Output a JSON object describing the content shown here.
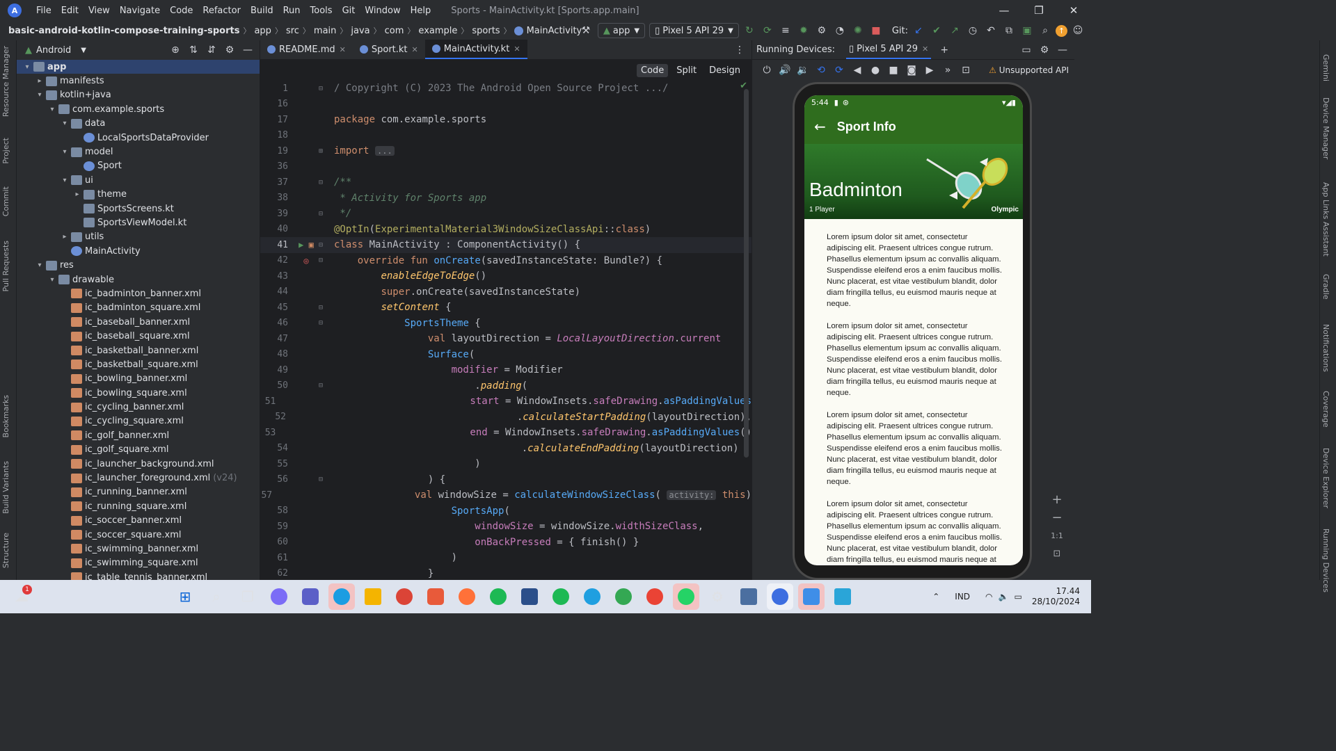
{
  "menubar": {
    "items": [
      "File",
      "Edit",
      "View",
      "Navigate",
      "Code",
      "Refactor",
      "Build",
      "Run",
      "Tools",
      "Git",
      "Window",
      "Help"
    ],
    "title": "Sports - MainActivity.kt [Sports.app.main]"
  },
  "breadcrumb": [
    "basic-android-kotlin-compose-training-sports",
    "app",
    "src",
    "main",
    "java",
    "com",
    "example",
    "sports",
    "MainActivity"
  ],
  "toolbar": {
    "config": "app",
    "device": "Pixel 5 API 29",
    "git_label": "Git:"
  },
  "project": {
    "view": "Android",
    "tree": [
      {
        "label": "app",
        "depth": 0,
        "arrow": "▾",
        "icon": "fold",
        "sel": true
      },
      {
        "label": "manifests",
        "depth": 1,
        "arrow": "▸",
        "icon": "fold"
      },
      {
        "label": "kotlin+java",
        "depth": 1,
        "arrow": "▾",
        "icon": "fold"
      },
      {
        "label": "com.example.sports",
        "depth": 2,
        "arrow": "▾",
        "icon": "fold"
      },
      {
        "label": "data",
        "depth": 3,
        "arrow": "▾",
        "icon": "fold"
      },
      {
        "label": "LocalSportsDataProvider",
        "depth": 4,
        "arrow": "",
        "icon": "kt"
      },
      {
        "label": "model",
        "depth": 3,
        "arrow": "▾",
        "icon": "fold"
      },
      {
        "label": "Sport",
        "depth": 4,
        "arrow": "",
        "icon": "kt"
      },
      {
        "label": "ui",
        "depth": 3,
        "arrow": "▾",
        "icon": "fold"
      },
      {
        "label": "theme",
        "depth": 4,
        "arrow": "▸",
        "icon": "fold"
      },
      {
        "label": "SportsScreens.kt",
        "depth": 4,
        "arrow": "",
        "icon": "fold"
      },
      {
        "label": "SportsViewModel.kt",
        "depth": 4,
        "arrow": "",
        "icon": "fold"
      },
      {
        "label": "utils",
        "depth": 3,
        "arrow": "▸",
        "icon": "fold"
      },
      {
        "label": "MainActivity",
        "depth": 3,
        "arrow": "",
        "icon": "kt"
      },
      {
        "label": "res",
        "depth": 1,
        "arrow": "▾",
        "icon": "fold"
      },
      {
        "label": "drawable",
        "depth": 2,
        "arrow": "▾",
        "icon": "fold"
      },
      {
        "label": "ic_badminton_banner.xml",
        "depth": 3,
        "arrow": "",
        "icon": "xmlf"
      },
      {
        "label": "ic_badminton_square.xml",
        "depth": 3,
        "arrow": "",
        "icon": "xmlf"
      },
      {
        "label": "ic_baseball_banner.xml",
        "depth": 3,
        "arrow": "",
        "icon": "xmlf"
      },
      {
        "label": "ic_baseball_square.xml",
        "depth": 3,
        "arrow": "",
        "icon": "xmlf"
      },
      {
        "label": "ic_basketball_banner.xml",
        "depth": 3,
        "arrow": "",
        "icon": "xmlf"
      },
      {
        "label": "ic_basketball_square.xml",
        "depth": 3,
        "arrow": "",
        "icon": "xmlf"
      },
      {
        "label": "ic_bowling_banner.xml",
        "depth": 3,
        "arrow": "",
        "icon": "xmlf"
      },
      {
        "label": "ic_bowling_square.xml",
        "depth": 3,
        "arrow": "",
        "icon": "xmlf"
      },
      {
        "label": "ic_cycling_banner.xml",
        "depth": 3,
        "arrow": "",
        "icon": "xmlf"
      },
      {
        "label": "ic_cycling_square.xml",
        "depth": 3,
        "arrow": "",
        "icon": "xmlf"
      },
      {
        "label": "ic_golf_banner.xml",
        "depth": 3,
        "arrow": "",
        "icon": "xmlf"
      },
      {
        "label": "ic_golf_square.xml",
        "depth": 3,
        "arrow": "",
        "icon": "xmlf"
      },
      {
        "label": "ic_launcher_background.xml",
        "depth": 3,
        "arrow": "",
        "icon": "xmlf"
      },
      {
        "label": "ic_launcher_foreground.xml",
        "depth": 3,
        "arrow": "",
        "icon": "xmlf",
        "dim": "(v24)"
      },
      {
        "label": "ic_running_banner.xml",
        "depth": 3,
        "arrow": "",
        "icon": "xmlf"
      },
      {
        "label": "ic_running_square.xml",
        "depth": 3,
        "arrow": "",
        "icon": "xmlf"
      },
      {
        "label": "ic_soccer_banner.xml",
        "depth": 3,
        "arrow": "",
        "icon": "xmlf"
      },
      {
        "label": "ic_soccer_square.xml",
        "depth": 3,
        "arrow": "",
        "icon": "xmlf"
      },
      {
        "label": "ic_swimming_banner.xml",
        "depth": 3,
        "arrow": "",
        "icon": "xmlf"
      },
      {
        "label": "ic_swimming_square.xml",
        "depth": 3,
        "arrow": "",
        "icon": "xmlf"
      },
      {
        "label": "ic_table_tennis_banner.xml",
        "depth": 3,
        "arrow": "",
        "icon": "xmlf"
      }
    ]
  },
  "tabs": [
    {
      "label": "README.md",
      "color": "#6b8fd6"
    },
    {
      "label": "Sport.kt",
      "color": "#6b8fd6"
    },
    {
      "label": "MainActivity.kt",
      "color": "#6b8fd6",
      "active": true
    }
  ],
  "viewmodes": [
    "Code",
    "Split",
    "Design"
  ],
  "left_tools": [
    "Resource Manager",
    "Project",
    "Commit",
    "Pull Requests",
    "Bookmarks",
    "Build Variants",
    "Structure"
  ],
  "right_tools": [
    "Gemini",
    "Device Manager",
    "App Links Assistant",
    "Gradle",
    "Notifications",
    "Coverage",
    "Device Explorer",
    "Running Devices"
  ],
  "devices": {
    "header": "Running Devices:",
    "tab": "Pixel 5 API 29",
    "warning": "Unsupported API"
  },
  "phone": {
    "time": "5:44",
    "appbar_title": "Sport Info",
    "sport": "Badminton",
    "players": "1 Player",
    "olympic": "Olympic",
    "paragraph": "Lorem ipsum dolor sit amet, consectetur adipiscing elit. Praesent ultrices congue rutrum. Phasellus elementum ipsum ac convallis aliquam. Suspendisse eleifend eros a enim faucibus mollis. Nunc placerat, est vitae vestibulum blandit, dolor diam fringilla tellus, eu euismod mauris neque at neque.",
    "paragraph_count": 4
  },
  "zoom": {
    "ratio": "1:1"
  },
  "tray": {
    "lang": "IND",
    "time": "17.44",
    "date": "28/10/2024",
    "weather_badge": "1"
  },
  "colors": {
    "appbar": "#2f6d1e",
    "accent": "#3574f0"
  }
}
